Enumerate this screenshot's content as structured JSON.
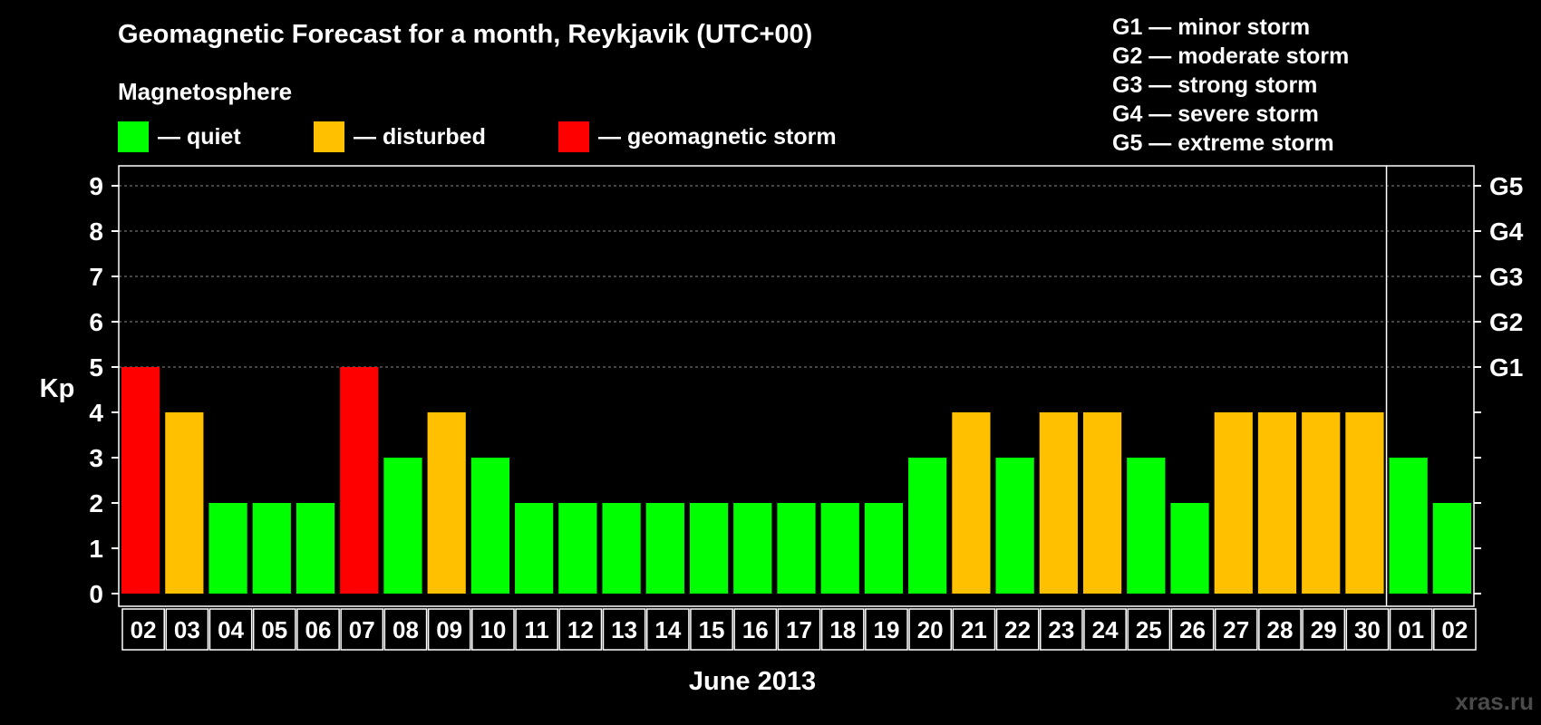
{
  "header": {
    "title": "Geomagnetic Forecast for a month, Reykjavik (UTC+00)",
    "magnetosphere_label": "Magnetosphere"
  },
  "legend": [
    {
      "label": "— quiet",
      "color": "#00ff00"
    },
    {
      "label": "— disturbed",
      "color": "#ffc000"
    },
    {
      "label": "— geomagnetic storm",
      "color": "#ff0000"
    }
  ],
  "storm_scale": [
    "G1 — minor storm",
    "G2 — moderate storm",
    "G3 — strong storm",
    "G4 — severe storm",
    "G5 — extreme storm"
  ],
  "colors": {
    "quiet": "#00ff00",
    "disturbed": "#ffc000",
    "storm": "#ff0000"
  },
  "chart_data": {
    "type": "bar",
    "ylabel": "Kp",
    "xlabel": "June 2013",
    "ylim": [
      0,
      9
    ],
    "yticks": [
      "0",
      "1",
      "2",
      "3",
      "4",
      "5",
      "6",
      "7",
      "8",
      "9"
    ],
    "right_axis": [
      {
        "value": 5,
        "label": "G1"
      },
      {
        "value": 6,
        "label": "G2"
      },
      {
        "value": 7,
        "label": "G3"
      },
      {
        "value": 8,
        "label": "G4"
      },
      {
        "value": 9,
        "label": "G5"
      }
    ],
    "grid": "dashed horizontal at 5-9",
    "month_divider_after": "30",
    "categories": [
      "02",
      "03",
      "04",
      "05",
      "06",
      "07",
      "08",
      "09",
      "10",
      "11",
      "12",
      "13",
      "14",
      "15",
      "16",
      "17",
      "18",
      "19",
      "20",
      "21",
      "22",
      "23",
      "24",
      "25",
      "26",
      "27",
      "28",
      "29",
      "30",
      "01",
      "02"
    ],
    "values": [
      5,
      4,
      2,
      2,
      2,
      5,
      3,
      4,
      3,
      2,
      2,
      2,
      2,
      2,
      2,
      2,
      2,
      2,
      3,
      4,
      3,
      4,
      4,
      3,
      2,
      4,
      4,
      4,
      4,
      3,
      2
    ]
  },
  "watermark": "xras.ru"
}
